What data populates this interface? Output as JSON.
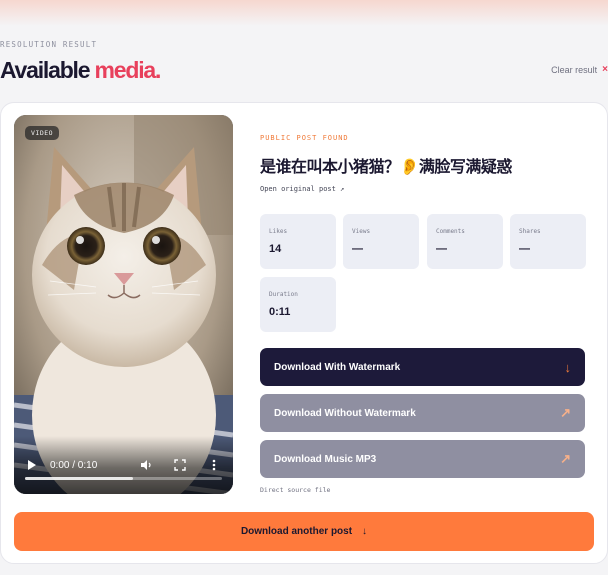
{
  "header": {
    "eyebrow": "RESOLUTION RESULT",
    "title_part1": "Available",
    "title_part2": "media.",
    "clear_label": "Clear result",
    "clear_icon": "×"
  },
  "video": {
    "badge": "VIDEO",
    "time": "0:00 / 0:10",
    "progress": 0.55,
    "icons": [
      "play-icon",
      "volume-icon",
      "fullscreen-icon",
      "more-vertical-icon"
    ]
  },
  "post": {
    "status": "PUBLIC POST FOUND",
    "title": "是谁在叫本小猪猫？👂满脸写满疑惑",
    "open_link": "Open original post ↗"
  },
  "stats": [
    {
      "label": "Likes",
      "value": "14"
    },
    {
      "label": "Views",
      "value": "—"
    },
    {
      "label": "Comments",
      "value": "—"
    },
    {
      "label": "Shares",
      "value": "—"
    },
    {
      "label": "Duration",
      "value": "0:11"
    }
  ],
  "downloads": [
    {
      "label": "Download With Watermark",
      "arrow": "↓"
    },
    {
      "label": "Download Without Watermark",
      "arrow": "↗"
    },
    {
      "label": "Download Music MP3",
      "arrow": "↗"
    }
  ],
  "note": "Direct source file",
  "another": {
    "label": "Download another post",
    "arrow": "↓"
  },
  "colors": {
    "accent": "#e8405c",
    "orange": "#ff7a3c",
    "dark": "#1d1a3a",
    "grey": "#8f8fa1"
  }
}
